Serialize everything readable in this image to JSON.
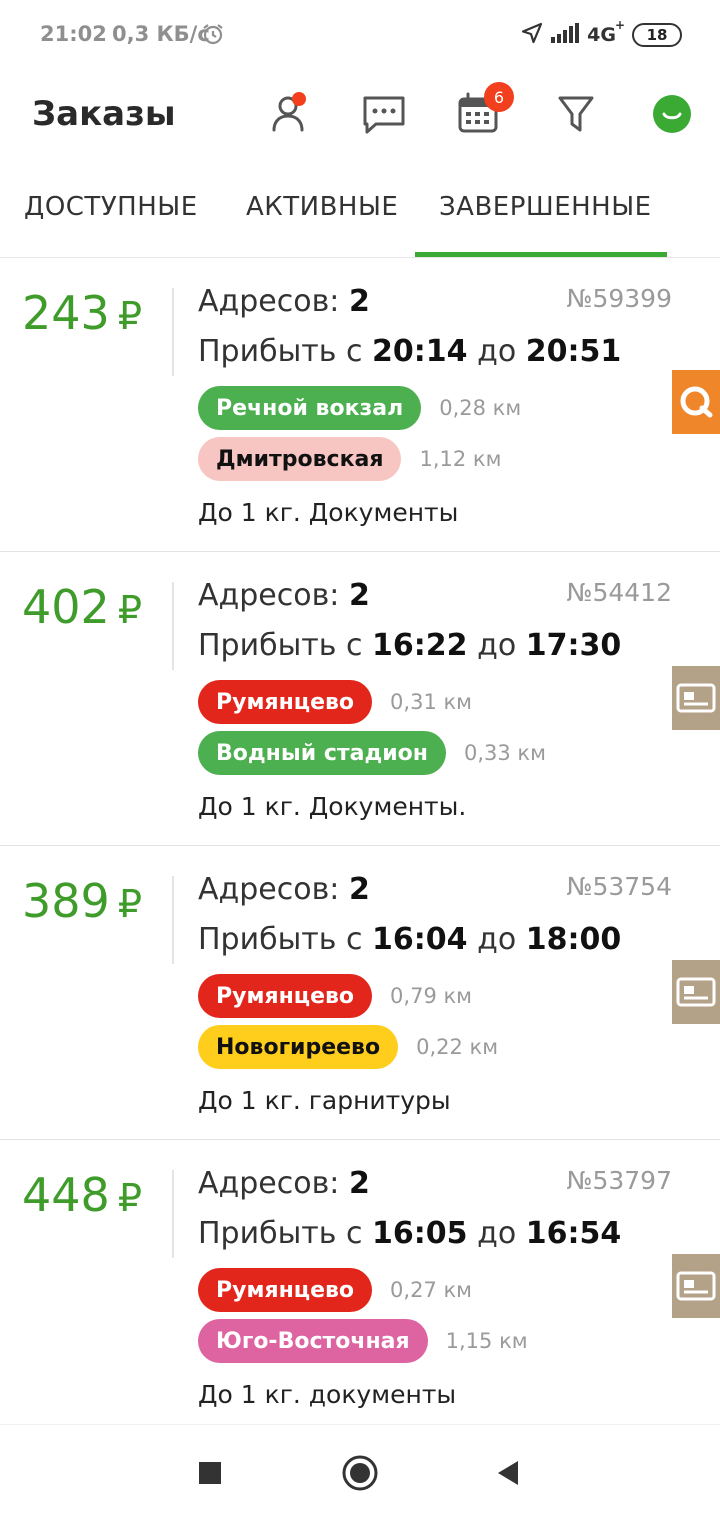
{
  "status_bar": {
    "time": "21:02",
    "net_speed": "0,3 КБ/с",
    "network": "4G",
    "battery": "18"
  },
  "app_bar": {
    "title": "Заказы",
    "calendar_badge": "6"
  },
  "tabs": [
    {
      "label": "ДОСТУПНЫЕ",
      "active": false
    },
    {
      "label": "АКТИВНЫЕ",
      "active": false
    },
    {
      "label": "ЗАВЕРШЕННЫЕ",
      "active": true
    }
  ],
  "labels": {
    "addresses": "Адресов:",
    "arrive_from": "Прибыть с",
    "arrive_to": "до",
    "currency": "₽"
  },
  "orders": [
    {
      "price": "243",
      "addresses_count": "2",
      "number": "№59399",
      "time_from": "20:14",
      "time_to": "20:51",
      "stops": [
        {
          "station": "Речной вокзал",
          "color": "#4caf50",
          "text_color": "#ffffff",
          "distance": "0,28 км"
        },
        {
          "station": "Дмитровская",
          "color": "#f7c6c2",
          "text_color": "#111111",
          "distance": "1,12 км"
        }
      ],
      "description": "До 1 кг. Документы",
      "payment_icon": "qiwi-icon",
      "payment_color": "#f0862a"
    },
    {
      "price": "402",
      "addresses_count": "2",
      "number": "№54412",
      "time_from": "16:22",
      "time_to": "17:30",
      "stops": [
        {
          "station": "Румянцево",
          "color": "#e3261c",
          "text_color": "#ffffff",
          "distance": "0,31 км"
        },
        {
          "station": "Водный стадион",
          "color": "#4caf50",
          "text_color": "#ffffff",
          "distance": "0,33 км"
        }
      ],
      "description": "До 1 кг. Документы.",
      "payment_icon": "card-icon",
      "payment_color": "#b3a287"
    },
    {
      "price": "389",
      "addresses_count": "2",
      "number": "№53754",
      "time_from": "16:04",
      "time_to": "18:00",
      "stops": [
        {
          "station": "Румянцево",
          "color": "#e3261c",
          "text_color": "#ffffff",
          "distance": "0,79 км"
        },
        {
          "station": "Новогиреево",
          "color": "#ffcd1c",
          "text_color": "#111111",
          "distance": "0,22 км"
        }
      ],
      "description": "До 1 кг. гарнитуры",
      "payment_icon": "card-icon",
      "payment_color": "#b3a287"
    },
    {
      "price": "448",
      "addresses_count": "2",
      "number": "№53797",
      "time_from": "16:05",
      "time_to": "16:54",
      "stops": [
        {
          "station": "Румянцево",
          "color": "#e3261c",
          "text_color": "#ffffff",
          "distance": "0,27 км"
        },
        {
          "station": "Юго-Восточная",
          "color": "#de64a1",
          "text_color": "#ffffff",
          "distance": "1,15 км"
        }
      ],
      "description": "До 1 кг. документы",
      "payment_icon": "card-icon",
      "payment_color": "#b3a287"
    }
  ],
  "colors": {
    "accent_green": "#3aaa35",
    "price_green": "#3f9c2b",
    "badge_red": "#f2401f"
  }
}
